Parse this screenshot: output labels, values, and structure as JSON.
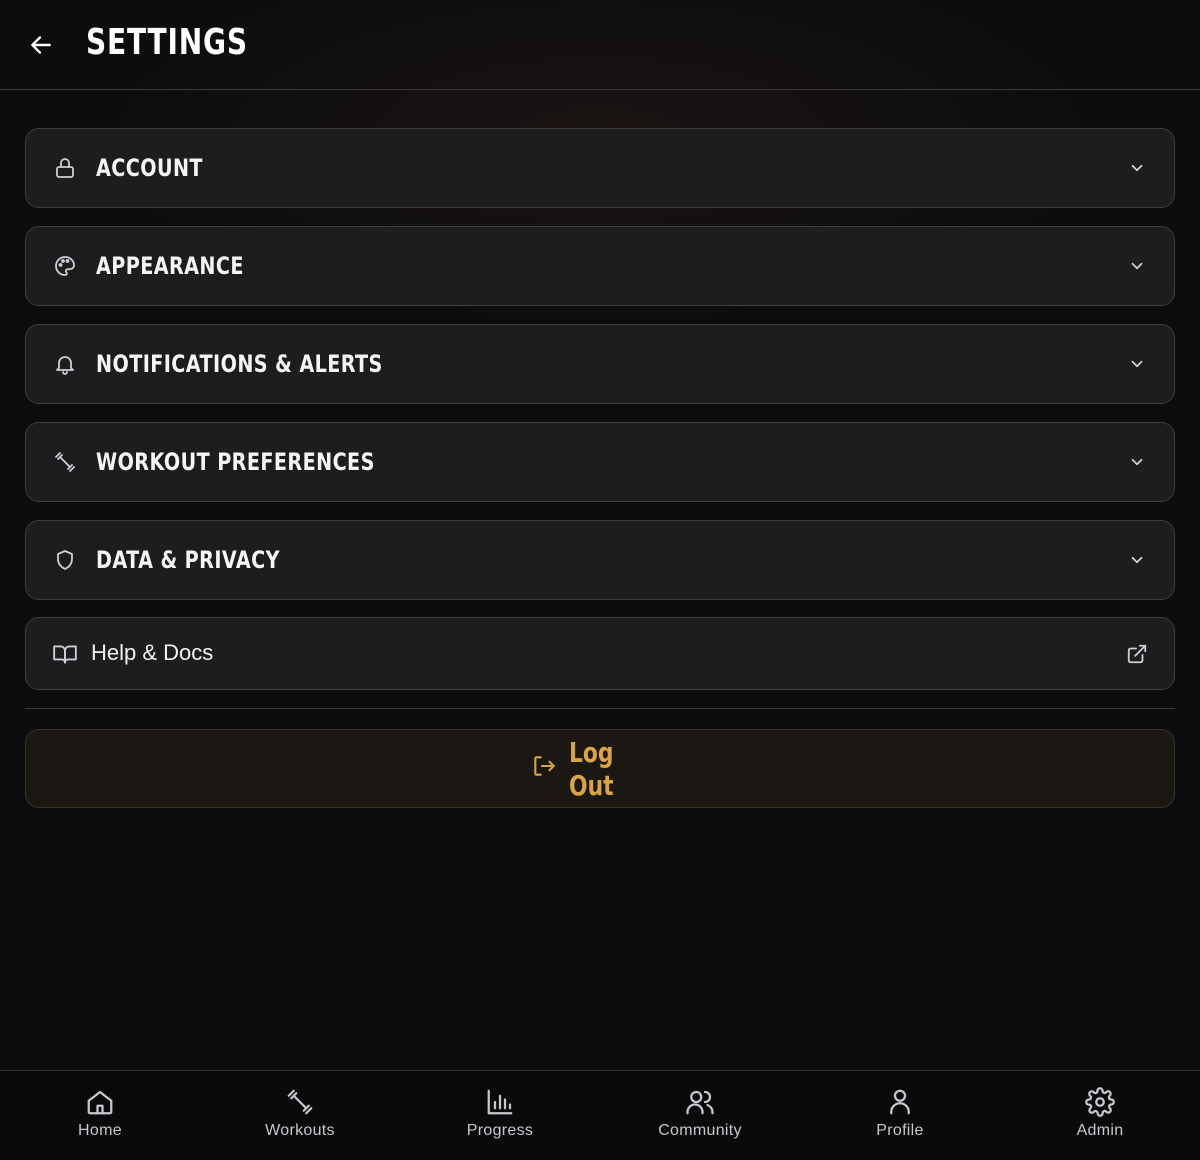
{
  "header": {
    "title": "SETTINGS",
    "back_icon": "arrow-left-icon"
  },
  "sections": [
    {
      "label": "ACCOUNT",
      "icon": "lock-icon"
    },
    {
      "label": "APPEARANCE",
      "icon": "palette-icon"
    },
    {
      "label": "NOTIFICATIONS & ALERTS",
      "icon": "bell-icon"
    },
    {
      "label": "WORKOUT PREFERENCES",
      "icon": "dumbbell-icon"
    },
    {
      "label": "DATA & PRIVACY",
      "icon": "shield-icon"
    }
  ],
  "help": {
    "label": "Help & Docs",
    "icon": "book-icon",
    "action_icon": "external-link-icon"
  },
  "logout": {
    "label": "Log Out",
    "icon": "logout-icon",
    "color": "#d9a441"
  },
  "bottom_nav": [
    {
      "label": "Home",
      "icon": "home-icon"
    },
    {
      "label": "Workouts",
      "icon": "dumbbell-icon"
    },
    {
      "label": "Progress",
      "icon": "bar-chart-icon"
    },
    {
      "label": "Community",
      "icon": "users-icon"
    },
    {
      "label": "Profile",
      "icon": "user-icon"
    },
    {
      "label": "Admin",
      "icon": "gear-icon"
    }
  ]
}
